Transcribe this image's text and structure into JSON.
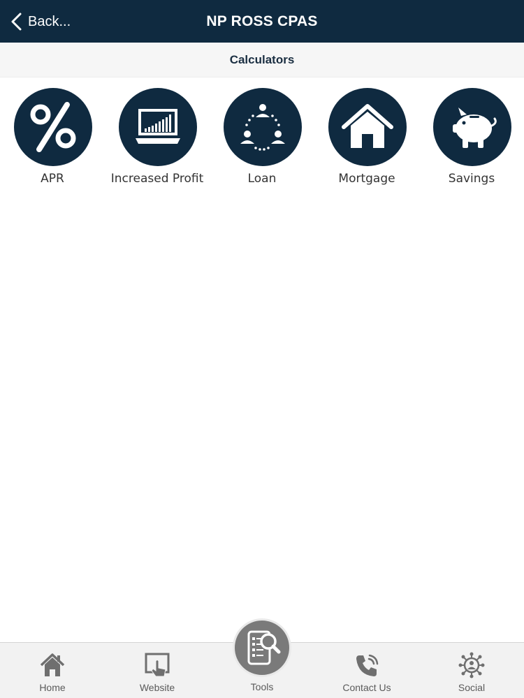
{
  "header": {
    "back_label": "Back...",
    "title": "NP ROSS CPAS",
    "background_color": "#0f2a40"
  },
  "section": {
    "title": "Calculators"
  },
  "calculators": [
    {
      "label": "APR",
      "icon": "percent-icon"
    },
    {
      "label": "Increased Profit",
      "icon": "laptop-chart-icon"
    },
    {
      "label": "Loan",
      "icon": "people-network-icon"
    },
    {
      "label": "Mortgage",
      "icon": "house-icon"
    },
    {
      "label": "Savings",
      "icon": "piggy-bank-icon"
    }
  ],
  "tab_bar": {
    "items": [
      {
        "label": "Home",
        "icon": "home-icon"
      },
      {
        "label": "Website",
        "icon": "website-touch-icon"
      },
      {
        "label": "Tools",
        "icon": "tools-search-icon",
        "active": true
      },
      {
        "label": "Contact Us",
        "icon": "phone-icon"
      },
      {
        "label": "Social",
        "icon": "social-network-icon"
      }
    ]
  }
}
